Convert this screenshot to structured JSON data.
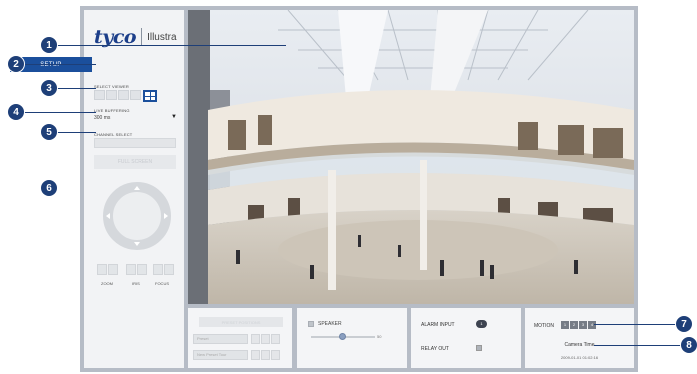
{
  "logo": {
    "brand": "tyco",
    "product": "Illustra"
  },
  "sidebar": {
    "setup_label": "SETUP",
    "select_viewer_label": "SELECT VIEWER",
    "live_buffering_label": "LIVE BUFFERING",
    "live_buffering_value": "300 ms",
    "channel_select_label": "CHANNEL SELECT",
    "full_screen_label": "FULL SCREEN",
    "controls": [
      {
        "label": "ZOOM"
      },
      {
        "label": "IRIS"
      },
      {
        "label": "FOCUS"
      }
    ]
  },
  "presets": {
    "header_label": "PRESET POSITIONS",
    "preset_placeholder": "Preset",
    "new_preset_placeholder": "New Preset Tour"
  },
  "audio": {
    "speaker_label": "SPEAKER",
    "speaker_volume": 50,
    "speaker_value_label": "50"
  },
  "io": {
    "alarm_input_label": "ALARM INPUT",
    "alarm_input_value": "1",
    "relay_out_label": "RELAY OUT"
  },
  "status": {
    "motion_label": "MOTION",
    "motion_zones": [
      "1",
      "2",
      "3",
      "4"
    ],
    "camera_time_label": "Camera Time",
    "camera_time_value": "2009-01-01 01:02:16"
  },
  "callouts": [
    "1",
    "2",
    "3",
    "4",
    "5",
    "6",
    "7",
    "8"
  ],
  "colors": {
    "brand_blue": "#1b4f9c",
    "callout_navy": "#1e3f78",
    "frame_gray": "#b6bcc6"
  }
}
